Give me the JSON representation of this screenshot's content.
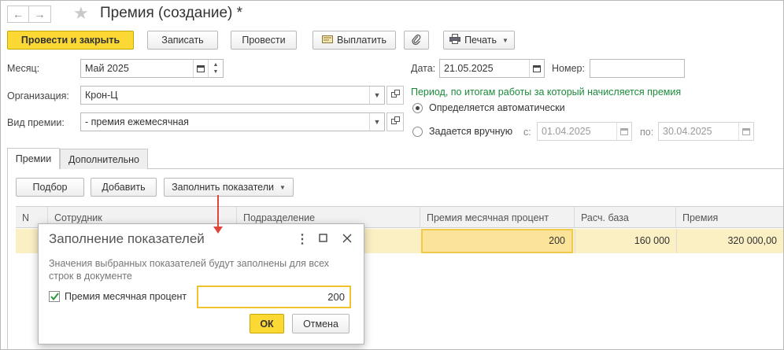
{
  "window": {
    "title": "Премия (создание) *"
  },
  "nav": {
    "back": "←",
    "forward": "→"
  },
  "toolbar": {
    "post_and_close": "Провести и закрыть",
    "save": "Записать",
    "post": "Провести",
    "pay": "Выплатить",
    "print": "Печать"
  },
  "form": {
    "month_label": "Месяц:",
    "month_value": "Май 2025",
    "date_label": "Дата:",
    "date_value": "21.05.2025",
    "number_label": "Номер:",
    "number_value": "",
    "org_label": "Организация:",
    "org_value": "Крон-Ц",
    "bonus_type_label": "Вид премии:",
    "bonus_type_value": "- премия ежемесячная",
    "period_caption": "Период, по итогам работы за который начисляется премия",
    "period_auto": "Определяется автоматически",
    "period_manual": "Задается вручную",
    "from_label": "с:",
    "from_value": "01.04.2025",
    "to_label": "по:",
    "to_value": "30.04.2025",
    "period_mode": "auto"
  },
  "tabs": [
    {
      "label": "Премии",
      "active": true
    },
    {
      "label": "Дополнительно",
      "active": false
    }
  ],
  "table_toolbar": {
    "pick": "Подбор",
    "add": "Добавить",
    "fill_indicators": "Заполнить показатели"
  },
  "table": {
    "columns": [
      "N",
      "Сотрудник",
      "Подразделение",
      "Премия месячная процент",
      "Расч. база",
      "Премия"
    ],
    "rows": [
      {
        "n": "",
        "employee": "",
        "department": "",
        "percent": "200",
        "base": "160 000",
        "bonus": "320 000,00"
      }
    ]
  },
  "dialog": {
    "title": "Заполнение показателей",
    "hint": "Значения выбранных показателей будут заполнены для всех строк в документе",
    "indicator_label": "Премия месячная процент",
    "indicator_checked": true,
    "indicator_value": "200",
    "ok": "ОК",
    "cancel": "Отмена"
  },
  "colors": {
    "accent": "#fbd834",
    "highlight_row": "#fbefc4",
    "period_caption": "#1a8a3a",
    "arrow": "#e0443e"
  }
}
